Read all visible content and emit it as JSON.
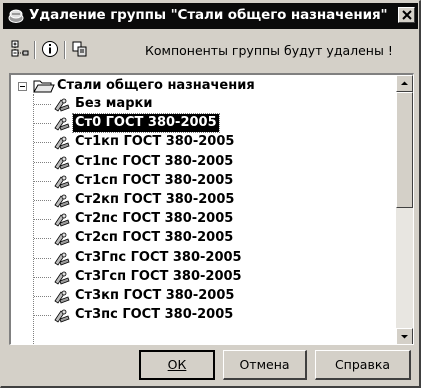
{
  "dialog": {
    "title": "Удаление группы \"Стали общего назначения\""
  },
  "toolbar": {
    "message": "Компоненты группы будут удалены !",
    "icons": [
      "tree-expand-icon",
      "info-icon",
      "copy-icon"
    ]
  },
  "tree": {
    "root": {
      "label": "Стали общего назначения",
      "expanded": true
    },
    "items": [
      {
        "label": "Без марки",
        "selected": false
      },
      {
        "label": "Ст0 ГОСТ 380-2005",
        "selected": true
      },
      {
        "label": "Ст1кп ГОСТ 380-2005",
        "selected": false
      },
      {
        "label": "Ст1пс ГОСТ 380-2005",
        "selected": false
      },
      {
        "label": "Ст1сп ГОСТ 380-2005",
        "selected": false
      },
      {
        "label": "Ст2кп ГОСТ 380-2005",
        "selected": false
      },
      {
        "label": "Ст2пс ГОСТ 380-2005",
        "selected": false
      },
      {
        "label": "Ст2сп ГОСТ 380-2005",
        "selected": false
      },
      {
        "label": "Ст3Гпс ГОСТ 380-2005",
        "selected": false
      },
      {
        "label": "Ст3Гсп ГОСТ 380-2005",
        "selected": false
      },
      {
        "label": "Ст3кп ГОСТ 380-2005",
        "selected": false
      },
      {
        "label": "Ст3пс ГОСТ 380-2005",
        "selected": false
      }
    ]
  },
  "buttons": {
    "ok": "ОК",
    "cancel": "Отмена",
    "help": "Справка"
  },
  "colors": {
    "titlebar": "#0a0a0a",
    "face": "#d4d0c8",
    "selection": "#000000"
  }
}
